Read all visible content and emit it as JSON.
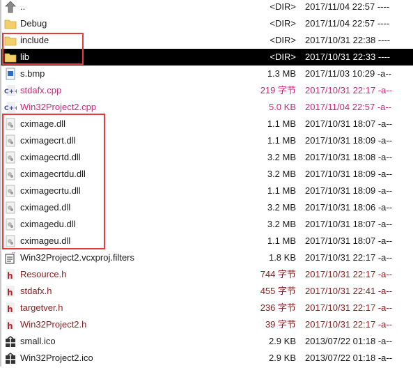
{
  "colors": {
    "cpp": "#d4237a",
    "header": "#8b1a1a",
    "normal": "#1a1a1a",
    "highlight_box": "#e8393d"
  },
  "files": [
    {
      "name": "..",
      "size": "<DIR>",
      "date": "2017/11/04 22:57 ----",
      "icon": "up-arrow-icon",
      "type": "normal"
    },
    {
      "name": "Debug",
      "size": "<DIR>",
      "date": "2017/11/04 22:57 ----",
      "icon": "folder-icon",
      "type": "normal"
    },
    {
      "name": "include",
      "size": "<DIR>",
      "date": "2017/10/31 22:38 ----",
      "icon": "folder-icon",
      "type": "normal"
    },
    {
      "name": "lib",
      "size": "<DIR>",
      "date": "2017/10/31 22:33 ----",
      "icon": "folder-icon",
      "type": "normal",
      "selected": true
    },
    {
      "name": "s.bmp",
      "size": "1.3 MB",
      "date": "2017/11/03 10:29 -a--",
      "icon": "image-file-icon",
      "type": "normal"
    },
    {
      "name": "stdafx.cpp",
      "size": "219 字节",
      "date": "2017/10/31 22:17 -a--",
      "icon": "cpp-file-icon",
      "type": "cpp"
    },
    {
      "name": "Win32Project2.cpp",
      "size": "5.0 KB",
      "date": "2017/11/04 22:57 -a--",
      "icon": "cpp-file-icon",
      "type": "cpp"
    },
    {
      "name": "cximage.dll",
      "size": "1.1 MB",
      "date": "2017/10/31 18:07 -a--",
      "icon": "dll-file-icon",
      "type": "normal"
    },
    {
      "name": "cximagecrt.dll",
      "size": "1.1 MB",
      "date": "2017/10/31 18:09 -a--",
      "icon": "dll-file-icon",
      "type": "normal"
    },
    {
      "name": "cximagecrtd.dll",
      "size": "3.2 MB",
      "date": "2017/10/31 18:08 -a--",
      "icon": "dll-file-icon",
      "type": "normal"
    },
    {
      "name": "cximagecrtdu.dll",
      "size": "3.2 MB",
      "date": "2017/10/31 18:09 -a--",
      "icon": "dll-file-icon",
      "type": "normal"
    },
    {
      "name": "cximagecrtu.dll",
      "size": "1.1 MB",
      "date": "2017/10/31 18:09 -a--",
      "icon": "dll-file-icon",
      "type": "normal"
    },
    {
      "name": "cximaged.dll",
      "size": "3.2 MB",
      "date": "2017/10/31 18:06 -a--",
      "icon": "dll-file-icon",
      "type": "normal"
    },
    {
      "name": "cximagedu.dll",
      "size": "3.2 MB",
      "date": "2017/10/31 18:07 -a--",
      "icon": "dll-file-icon",
      "type": "normal"
    },
    {
      "name": "cximageu.dll",
      "size": "1.1 MB",
      "date": "2017/10/31 18:07 -a--",
      "icon": "dll-file-icon",
      "type": "normal"
    },
    {
      "name": "Win32Project2.vcxproj.filters",
      "size": "1.8 KB",
      "date": "2017/10/31 22:17 -a--",
      "icon": "text-file-icon",
      "type": "normal"
    },
    {
      "name": "Resource.h",
      "size": "744 字节",
      "date": "2017/10/31 22:17 -a--",
      "icon": "header-file-icon",
      "type": "header"
    },
    {
      "name": "stdafx.h",
      "size": "455 字节",
      "date": "2017/10/31 22:41 -a--",
      "icon": "header-file-icon",
      "type": "header"
    },
    {
      "name": "targetver.h",
      "size": "236 字节",
      "date": "2017/10/31 22:17 -a--",
      "icon": "header-file-icon",
      "type": "header"
    },
    {
      "name": "Win32Project2.h",
      "size": "39 字节",
      "date": "2017/10/31 22:17 -a--",
      "icon": "header-file-icon",
      "type": "header"
    },
    {
      "name": "small.ico",
      "size": "2.9 KB",
      "date": "2013/07/22 01:18 -a--",
      "icon": "ico-file-icon",
      "type": "normal"
    },
    {
      "name": "Win32Project2.ico",
      "size": "2.9 KB",
      "date": "2013/07/22 01:18 -a--",
      "icon": "ico-file-icon",
      "type": "normal"
    }
  ]
}
